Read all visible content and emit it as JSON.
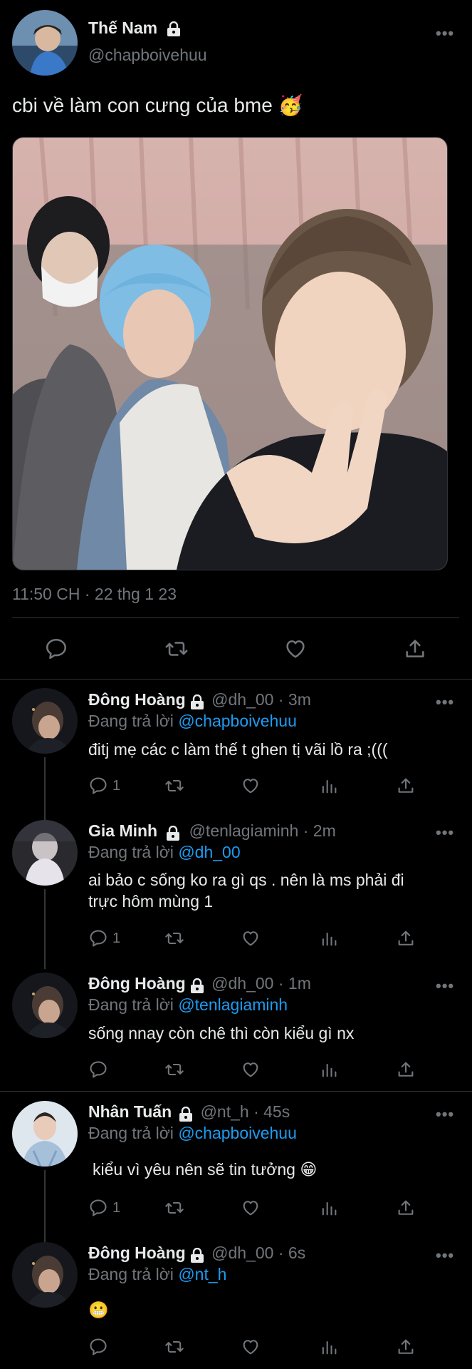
{
  "main_tweet": {
    "name": "Thế Nam",
    "handle": "@chapboivehuu",
    "text": "cbi về làm con cưng của bme",
    "emoji": "🥳",
    "timestamp": "11:50 CH · 22 thg 1 23",
    "more": "•••"
  },
  "replies": [
    {
      "name": "Đông Hoàng",
      "handle": "@dh_00 · 3m",
      "replying_prefix": "Đang trả lời",
      "replying_to": "@chapboivehuu",
      "text": "đitj mẹ các c làm thế t ghen tị vãi lồ ra ;(((",
      "reply_count": "1",
      "more": "•••"
    },
    {
      "name": "Gia Minh",
      "handle": "@tenlagiaminh · 2m",
      "replying_prefix": "Đang trả lời",
      "replying_to": "@dh_00",
      "text_line1": "ai bảo c sống ko ra gì qs . nên là ms phải đi",
      "text_line2": "trực hôm mùng 1",
      "reply_count": "1",
      "more": "•••"
    },
    {
      "name": "Đông Hoàng",
      "handle": "@dh_00 · 1m",
      "replying_prefix": "Đang trả lời",
      "replying_to": "@tenlagiaminh",
      "text": "sống nnay còn chê thì còn kiểu gì nx",
      "more": "•••"
    },
    {
      "name": "Nhân Tuấn",
      "handle": "@nt_h · 45s",
      "replying_prefix": "Đang trả lời",
      "replying_to": "@chapboivehuu",
      "text": "kiểu vì yêu nên sẽ tin tưởng",
      "emoji": "😁",
      "reply_count": "1",
      "more": "•••"
    },
    {
      "name": "Đông Hoàng",
      "handle": "@dh_00 · 6s",
      "replying_prefix": "Đang trả lời",
      "replying_to": "@nt_h",
      "emoji": "😬",
      "more": "•••"
    }
  ],
  "colors": {
    "background": "#000000",
    "text": "#e7e9ea",
    "secondary": "#71767b",
    "link": "#1d9bf0",
    "divider": "#2f3336"
  }
}
